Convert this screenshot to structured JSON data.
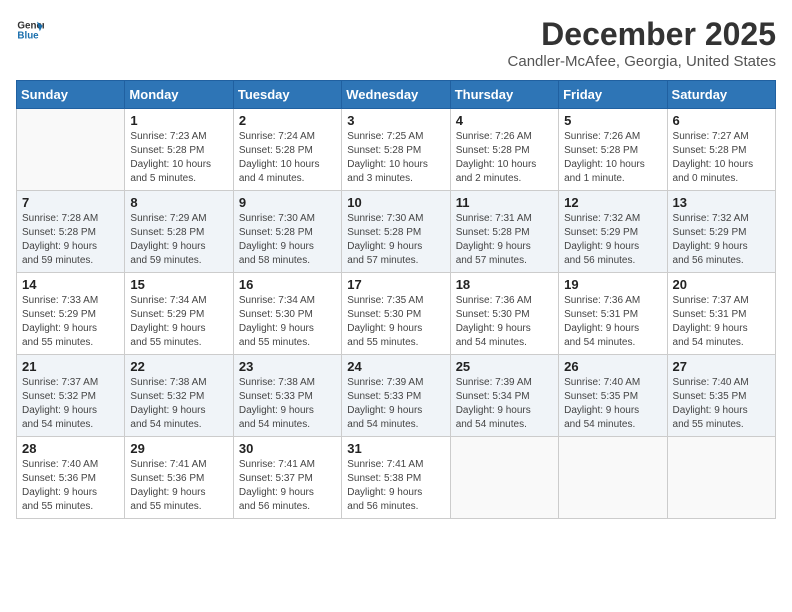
{
  "logo": {
    "line1": "General",
    "line2": "Blue"
  },
  "title": "December 2025",
  "location": "Candler-McAfee, Georgia, United States",
  "weekdays": [
    "Sunday",
    "Monday",
    "Tuesday",
    "Wednesday",
    "Thursday",
    "Friday",
    "Saturday"
  ],
  "weeks": [
    [
      {
        "num": "",
        "info": ""
      },
      {
        "num": "1",
        "info": "Sunrise: 7:23 AM\nSunset: 5:28 PM\nDaylight: 10 hours\nand 5 minutes."
      },
      {
        "num": "2",
        "info": "Sunrise: 7:24 AM\nSunset: 5:28 PM\nDaylight: 10 hours\nand 4 minutes."
      },
      {
        "num": "3",
        "info": "Sunrise: 7:25 AM\nSunset: 5:28 PM\nDaylight: 10 hours\nand 3 minutes."
      },
      {
        "num": "4",
        "info": "Sunrise: 7:26 AM\nSunset: 5:28 PM\nDaylight: 10 hours\nand 2 minutes."
      },
      {
        "num": "5",
        "info": "Sunrise: 7:26 AM\nSunset: 5:28 PM\nDaylight: 10 hours\nand 1 minute."
      },
      {
        "num": "6",
        "info": "Sunrise: 7:27 AM\nSunset: 5:28 PM\nDaylight: 10 hours\nand 0 minutes."
      }
    ],
    [
      {
        "num": "7",
        "info": "Sunrise: 7:28 AM\nSunset: 5:28 PM\nDaylight: 9 hours\nand 59 minutes."
      },
      {
        "num": "8",
        "info": "Sunrise: 7:29 AM\nSunset: 5:28 PM\nDaylight: 9 hours\nand 59 minutes."
      },
      {
        "num": "9",
        "info": "Sunrise: 7:30 AM\nSunset: 5:28 PM\nDaylight: 9 hours\nand 58 minutes."
      },
      {
        "num": "10",
        "info": "Sunrise: 7:30 AM\nSunset: 5:28 PM\nDaylight: 9 hours\nand 57 minutes."
      },
      {
        "num": "11",
        "info": "Sunrise: 7:31 AM\nSunset: 5:28 PM\nDaylight: 9 hours\nand 57 minutes."
      },
      {
        "num": "12",
        "info": "Sunrise: 7:32 AM\nSunset: 5:29 PM\nDaylight: 9 hours\nand 56 minutes."
      },
      {
        "num": "13",
        "info": "Sunrise: 7:32 AM\nSunset: 5:29 PM\nDaylight: 9 hours\nand 56 minutes."
      }
    ],
    [
      {
        "num": "14",
        "info": "Sunrise: 7:33 AM\nSunset: 5:29 PM\nDaylight: 9 hours\nand 55 minutes."
      },
      {
        "num": "15",
        "info": "Sunrise: 7:34 AM\nSunset: 5:29 PM\nDaylight: 9 hours\nand 55 minutes."
      },
      {
        "num": "16",
        "info": "Sunrise: 7:34 AM\nSunset: 5:30 PM\nDaylight: 9 hours\nand 55 minutes."
      },
      {
        "num": "17",
        "info": "Sunrise: 7:35 AM\nSunset: 5:30 PM\nDaylight: 9 hours\nand 55 minutes."
      },
      {
        "num": "18",
        "info": "Sunrise: 7:36 AM\nSunset: 5:30 PM\nDaylight: 9 hours\nand 54 minutes."
      },
      {
        "num": "19",
        "info": "Sunrise: 7:36 AM\nSunset: 5:31 PM\nDaylight: 9 hours\nand 54 minutes."
      },
      {
        "num": "20",
        "info": "Sunrise: 7:37 AM\nSunset: 5:31 PM\nDaylight: 9 hours\nand 54 minutes."
      }
    ],
    [
      {
        "num": "21",
        "info": "Sunrise: 7:37 AM\nSunset: 5:32 PM\nDaylight: 9 hours\nand 54 minutes."
      },
      {
        "num": "22",
        "info": "Sunrise: 7:38 AM\nSunset: 5:32 PM\nDaylight: 9 hours\nand 54 minutes."
      },
      {
        "num": "23",
        "info": "Sunrise: 7:38 AM\nSunset: 5:33 PM\nDaylight: 9 hours\nand 54 minutes."
      },
      {
        "num": "24",
        "info": "Sunrise: 7:39 AM\nSunset: 5:33 PM\nDaylight: 9 hours\nand 54 minutes."
      },
      {
        "num": "25",
        "info": "Sunrise: 7:39 AM\nSunset: 5:34 PM\nDaylight: 9 hours\nand 54 minutes."
      },
      {
        "num": "26",
        "info": "Sunrise: 7:40 AM\nSunset: 5:35 PM\nDaylight: 9 hours\nand 54 minutes."
      },
      {
        "num": "27",
        "info": "Sunrise: 7:40 AM\nSunset: 5:35 PM\nDaylight: 9 hours\nand 55 minutes."
      }
    ],
    [
      {
        "num": "28",
        "info": "Sunrise: 7:40 AM\nSunset: 5:36 PM\nDaylight: 9 hours\nand 55 minutes."
      },
      {
        "num": "29",
        "info": "Sunrise: 7:41 AM\nSunset: 5:36 PM\nDaylight: 9 hours\nand 55 minutes."
      },
      {
        "num": "30",
        "info": "Sunrise: 7:41 AM\nSunset: 5:37 PM\nDaylight: 9 hours\nand 56 minutes."
      },
      {
        "num": "31",
        "info": "Sunrise: 7:41 AM\nSunset: 5:38 PM\nDaylight: 9 hours\nand 56 minutes."
      },
      {
        "num": "",
        "info": ""
      },
      {
        "num": "",
        "info": ""
      },
      {
        "num": "",
        "info": ""
      }
    ]
  ]
}
